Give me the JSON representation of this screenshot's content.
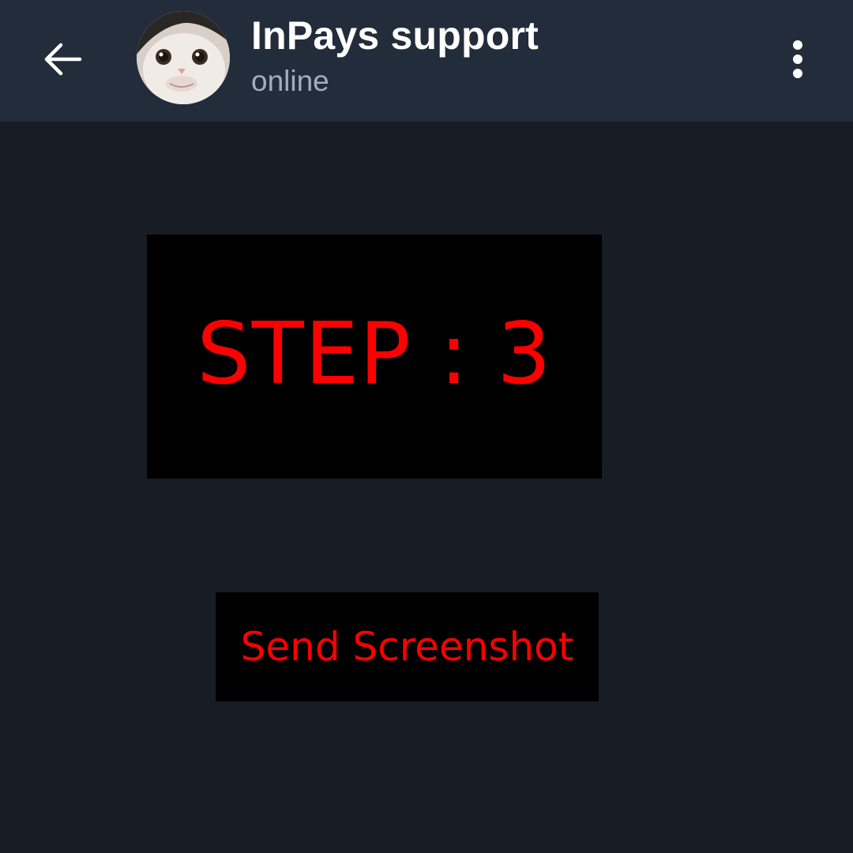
{
  "colors": {
    "header_bg": "#222c3b",
    "chat_bg": "#171c25",
    "title_text": "#ffffff",
    "status_text": "#a3adbb",
    "accent_red": "#ff0000",
    "box_bg": "#000000"
  },
  "header": {
    "back_icon": "arrow-left-icon",
    "avatar_icon": "cat-avatar",
    "title": "InPays support",
    "status": "online",
    "menu_icon": "more-vertical-icon"
  },
  "messages": {
    "step_image": {
      "text": "STEP : 3"
    },
    "screenshot_button": {
      "label": "Send Screenshot"
    }
  }
}
